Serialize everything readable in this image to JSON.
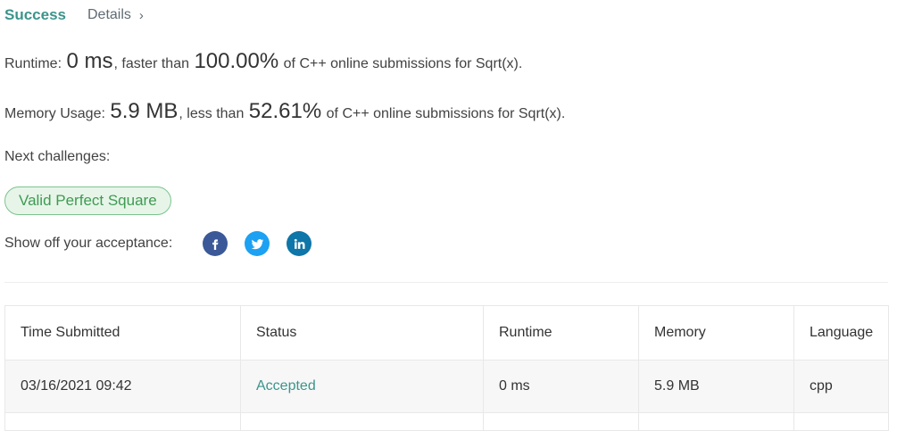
{
  "header": {
    "status": "Success",
    "details_label": "Details",
    "chevron": "›"
  },
  "runtime": {
    "label": "Runtime:",
    "value": "0 ms",
    "comparison": ", faster than",
    "percent": "100.00%",
    "suffix": "of C++ online submissions for Sqrt(x)."
  },
  "memory": {
    "label": "Memory Usage:",
    "value": "5.9 MB",
    "comparison": ", less than",
    "percent": "52.61%",
    "suffix": "of C++ online submissions for Sqrt(x)."
  },
  "next": {
    "label": "Next challenges:",
    "challenges": [
      "Valid Perfect Square"
    ]
  },
  "share": {
    "label": "Show off your acceptance:",
    "icons": [
      "facebook-icon",
      "twitter-icon",
      "linkedin-icon"
    ],
    "colors": {
      "facebook": "#3b5998",
      "twitter": "#1da1f2",
      "linkedin": "#0e76a8"
    }
  },
  "table": {
    "columns": [
      "Time Submitted",
      "Status",
      "Runtime",
      "Memory",
      "Language"
    ],
    "rows": [
      [
        "03/16/2021 09:42",
        "Accepted",
        "0 ms",
        "5.9 MB",
        "cpp"
      ]
    ]
  },
  "colors": {
    "accent": "#3c948b",
    "pill_text": "#3e9b52",
    "pill_bg": "#e7f5e9"
  }
}
